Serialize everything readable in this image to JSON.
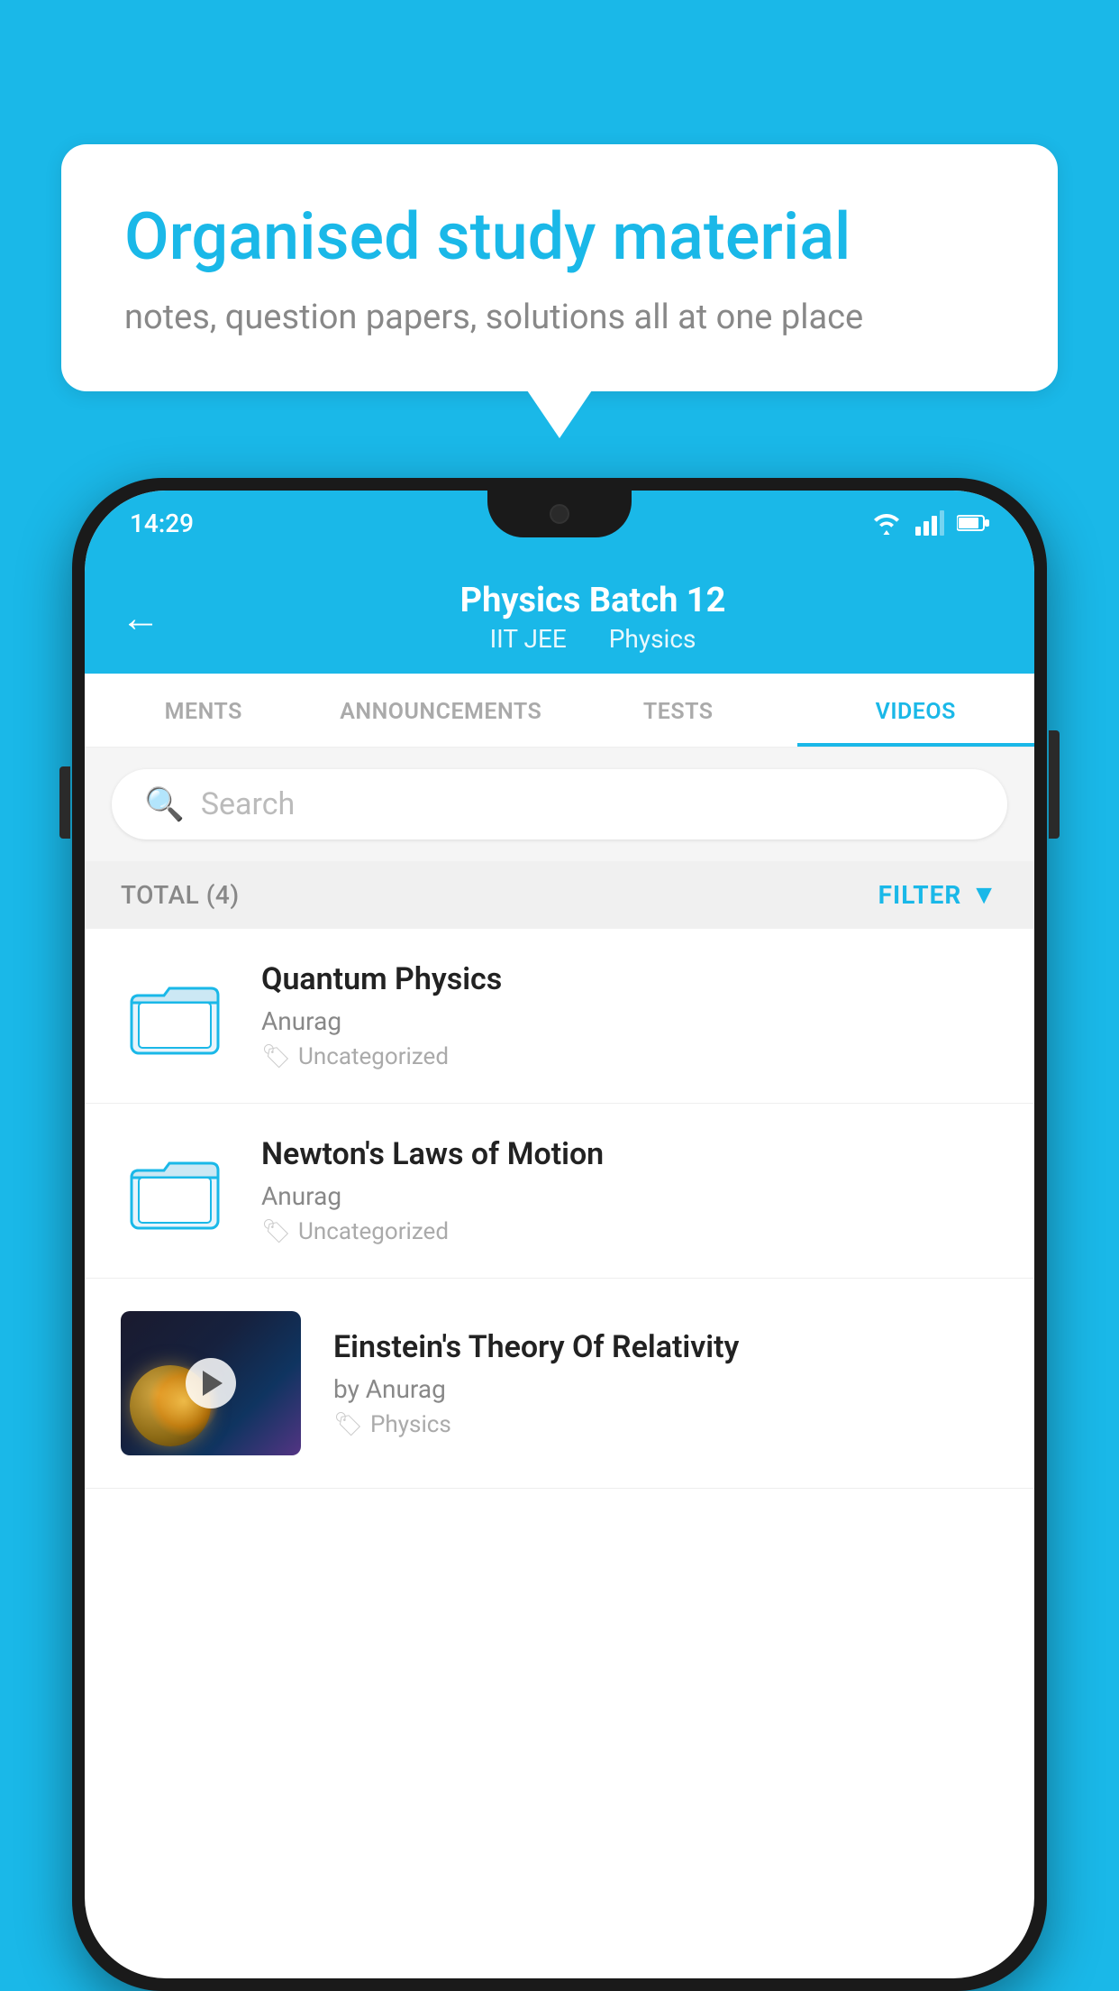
{
  "background_color": "#1ab8e8",
  "speech_bubble": {
    "title": "Organised study material",
    "subtitle": "notes, question papers, solutions all at one place"
  },
  "phone": {
    "status_bar": {
      "time": "14:29",
      "icons": [
        "wifi",
        "signal",
        "battery"
      ]
    },
    "header": {
      "back_label": "←",
      "title": "Physics Batch 12",
      "subtitle_parts": [
        "IIT JEE",
        "Physics"
      ]
    },
    "tabs": [
      {
        "label": "MENTS",
        "active": false
      },
      {
        "label": "ANNOUNCEMENTS",
        "active": false
      },
      {
        "label": "TESTS",
        "active": false
      },
      {
        "label": "VIDEOS",
        "active": true
      }
    ],
    "search": {
      "placeholder": "Search"
    },
    "filter_bar": {
      "total_label": "TOTAL (4)",
      "filter_label": "FILTER"
    },
    "video_items": [
      {
        "title": "Quantum Physics",
        "author": "Anurag",
        "tag": "Uncategorized",
        "type": "folder"
      },
      {
        "title": "Newton's Laws of Motion",
        "author": "Anurag",
        "tag": "Uncategorized",
        "type": "folder"
      },
      {
        "title": "Einstein's Theory Of Relativity",
        "author": "by Anurag",
        "tag": "Physics",
        "type": "video"
      }
    ]
  }
}
